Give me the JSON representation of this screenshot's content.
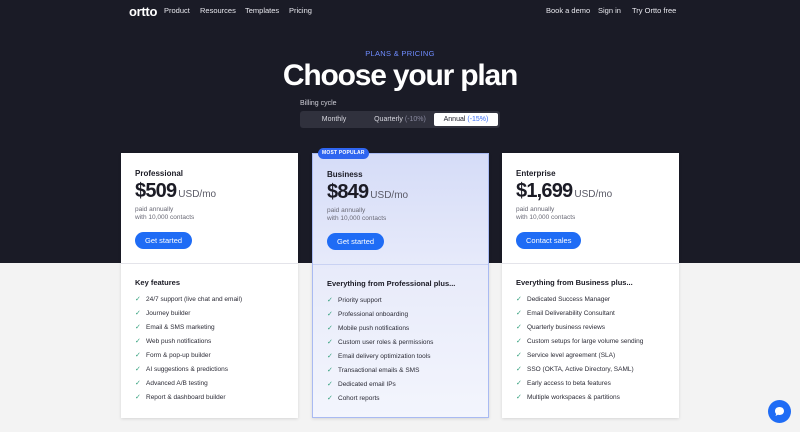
{
  "nav": {
    "logo": "ortto",
    "links": [
      "Product",
      "Resources",
      "Templates",
      "Pricing"
    ],
    "right": [
      "Book a demo",
      "Sign in",
      "Try Ortto free"
    ]
  },
  "hero": {
    "eyebrow": "PLANS & PRICING",
    "title": "Choose your plan",
    "billing_label": "Billing cycle",
    "billing_options": [
      {
        "label": "Monthly",
        "discount": ""
      },
      {
        "label": "Quarterly",
        "discount": "(-10%)"
      },
      {
        "label": "Annual",
        "discount": "(-15%)"
      }
    ],
    "billing_selected": "Annual"
  },
  "plans": [
    {
      "name": "Professional",
      "price": "$509",
      "unit": "USD/mo",
      "billing": "paid annually",
      "contacts": "with 10,000 contacts",
      "cta": "Get started",
      "features_heading": "Key features",
      "features": [
        "24/7 support (live chat and email)",
        "Journey builder",
        "Email & SMS marketing",
        "Web push notifications",
        "Form & pop-up builder",
        "AI suggestions & predictions",
        "Advanced A/B testing",
        "Report & dashboard builder"
      ]
    },
    {
      "name": "Business",
      "badge": "MOST POPULAR",
      "price": "$849",
      "unit": "USD/mo",
      "billing": "paid annually",
      "contacts": "with 10,000 contacts",
      "cta": "Get started",
      "features_heading": "Everything from Professional plus...",
      "features": [
        "Priority support",
        "Professional onboarding",
        "Mobile push notifications",
        "Custom user roles & permissions",
        "Email delivery optimization tools",
        "Transactional emails & SMS",
        "Dedicated email IPs",
        "Cohort reports"
      ]
    },
    {
      "name": "Enterprise",
      "price": "$1,699",
      "unit": "USD/mo",
      "billing": "paid annually",
      "contacts": "with 10,000 contacts",
      "cta": "Contact sales",
      "features_heading": "Everything from Business plus...",
      "features": [
        "Dedicated Success Manager",
        "Email Deliverability Consultant",
        "Quarterly business reviews",
        "Custom setups for large volume sending",
        "Service level agreement (SLA)",
        "SSO (OKTA, Active Directory, SAML)",
        "Early access to beta features",
        "Multiple workspaces & partitions"
      ]
    }
  ],
  "colors": {
    "hero_bg": "#1a1b26",
    "accent": "#1f6cf5",
    "check": "#2f9e7a",
    "eyebrow": "#6f8cff"
  },
  "icons": {
    "check": "check-icon",
    "chat": "chat-bubble-icon"
  }
}
